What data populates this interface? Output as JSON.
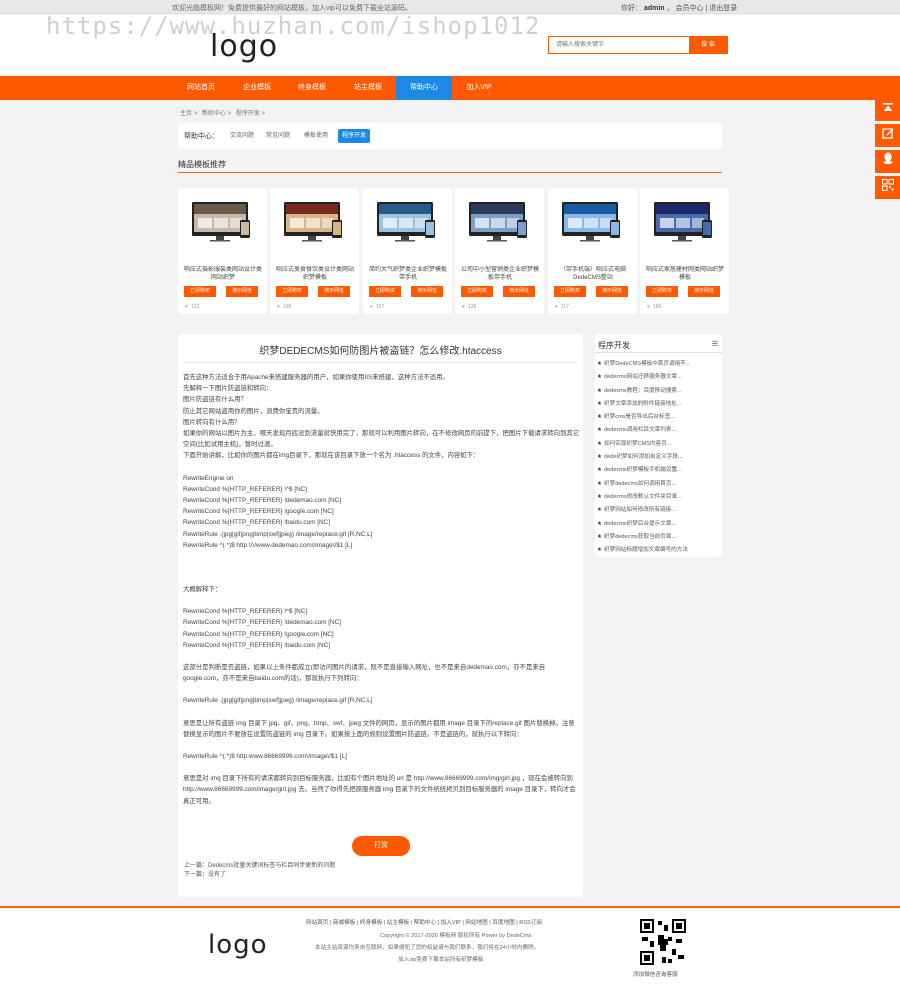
{
  "topbar": {
    "notice": "欢迎光临模板网！免费提供最好的网站模板，加入vip可以免费下载全站源码。",
    "welcome": "你好：",
    "user": "admin",
    "member": "会员中心",
    "logout": "退出登录"
  },
  "watermark": "https://www.huzhan.com/ishop1012",
  "header": {
    "logo": "logo",
    "search_placeholder": "请输入搜索关键字",
    "search_button": "搜 索"
  },
  "nav": {
    "items": [
      "网站首页",
      "企业模板",
      "终身模板",
      "站主模板",
      "帮助中心",
      "加入VIP"
    ]
  },
  "breadcrumb": [
    "主页",
    ">",
    "帮助中心",
    ">",
    "程序开发",
    ">"
  ],
  "help": {
    "label": "帮助中心：",
    "tabs": [
      "交流问题",
      "常见问题",
      "模板使用",
      "程序开发"
    ]
  },
  "section_title": "精品模板推荐",
  "cards": [
    {
      "title": "响应式摄影服装类网站设计类网站织梦",
      "buy": "立即购买",
      "demo": "演示网址",
      "views": "123"
    },
    {
      "title": "响应式美食餐饮类设计类网站织梦模板",
      "buy": "立即购买",
      "demo": "演示网址",
      "views": "198"
    },
    {
      "title": "简约大气织梦类企业织梦模板带手机",
      "buy": "立即购买",
      "demo": "演示网址",
      "views": "157"
    },
    {
      "title": "公司中小型营销类企业织梦模板带手机",
      "buy": "立即购买",
      "demo": "演示网址",
      "views": "138"
    },
    {
      "title": "（带手机端）响应式电脑DedeCMS整站",
      "buy": "立即购买",
      "demo": "演示网址",
      "views": "117"
    },
    {
      "title": "响应式家居建材网类网站织梦模板",
      "buy": "立即购买",
      "demo": "演示网址",
      "views": "189"
    }
  ],
  "article": {
    "title": "织梦DEDECMS如何防图片被盗链？怎么修改.htaccess",
    "lines": [
      "首先这种方法适合于用Apache来搭建服务器的用户，如果你使用IIS来搭建，这种方法不适用。",
      "先解释一下图片防盗链和转向：",
      "图片防盗链有什么用？",
      "防止其它网站盗用你的图片，浪费你宝贵的流量。",
      "图片转向有什么用？",
      "如果你的网站以图片为主，哪天发现月底没到流量就快用完了，那就可以利用图片转向，在不修改网页的前提下，把图片下载请求转向到其它空间(比如试用主机)，暂时过渡。",
      "下面开始讲解，比如你的图片都在img目录下，那就在该目录下放一个名为 .htaccess 的文件，内容如下：",
      "",
      "RewriteEngine on",
      "RewriteCond %{HTTP_REFERER} !^$ [NC]",
      "RewriteCond %{HTTP_REFERER} !dedemao.com [NC]",
      "RewriteCond %{HTTP_REFERER} !google.com [NC]",
      "RewriteCond %{HTTP_REFERER} !baidu.com [NC]",
      "RewriteRule .(jpg|gif|png|bmp|swf|jpeg) /image/replace.gif [R,NC,L]",
      "RewriteRule ^(.*)$ http:\\/\\/www.dedemao.com\\/image\\/$1 [L]",
      "",
      "",
      "",
      "大概解释下：",
      "",
      "RewriteCond %{HTTP_REFERER} !^$ [NC]",
      "RewriteCond %{HTTP_REFERER} !dedemao.com [NC]",
      "RewriteCond %{HTTP_REFERER} !google.com [NC]",
      "RewriteCond %{HTTP_REFERER} !baidu.com [NC]",
      "",
      "这部分是判断是否盗链，如果以上条件都成立(即访问图片的请求，既不是直接输入网址，也不是来自dedemao.com，亦不是来自google.com，亦不是来自baidu.com的话)，那就执行下列转向：",
      "",
      "RewriteRule .(jpg|gif|png|bmp|swf|jpeg) /image/replace.gif [R,NC,L]",
      "",
      "意思是让所有盗链 img 目录下 jpg、gif、png、bmp、swf、jpeg 文件的网页，显示的图片都用 image 目录下的replace.gif 图片替换掉。注意替换显示的图片不要放在设置防盗链的 img 目录下。如果按上面的规则设置图片防盗链，不是盗链的，就执行以下转向：",
      "",
      "RewriteRule ^(.*)$ http:www.86669999.com\\/image\\/$1 [L]",
      "",
      "意思是对 img 目录下所有的请求都转向到目标服务器，比如有个图片地址的 url 是 http://www.86669999.com/img/girl.jpg ，现在会被转向到 http://www.86669999.com/image/girl.jpg 去。当然了你得先把原服务器 img 目录下的文件统统拷贝到目标服务器的 image 目录下，转向才会真正可用。"
    ],
    "reward": "打赏",
    "prev": "上一篇：Dedecms批量关键词标签与栏目同步更新的问题",
    "next": "下一篇：没有了"
  },
  "sidebar": {
    "title": "程序开发",
    "items": [
      "织梦DedeCMS模板中首页调用不...",
      "dedecms网站迁移服务器文章...",
      "dedecms教程：百度移动搜索...",
      "织梦文章添加的附件链接地址...",
      "织梦cms是否导出后台标签...",
      "dedecms调用栏目文章列表...",
      "如何实现织梦CMS内容页...",
      "dede织梦如何添加自定义字段...",
      "dedecms织梦模板手机端设置...",
      "织梦dedecms如何调用首页...",
      "dedecms修改默认文件夹目录...",
      "织梦网站如何修改所有链接...",
      "dedecms织梦后台提示文章...",
      "织梦dedecms获取当前页面...",
      "织梦网站标题增加文章编号的方法"
    ]
  },
  "float_icons": [
    "up-arrow-icon",
    "edit-icon",
    "qq-icon",
    "qrcode-icon"
  ],
  "footer": {
    "logo": "logo",
    "links": "网站首页 | 商城模板 | 终身模板 | 站主模板 | 帮助中心 | 加入VIP | 网站地图 | 百度地图 | RSS订阅",
    "copyright": "Copyright © 2017-2020 模板网 版权所有 Power by DedeCms",
    "disclaimer": "本站主站资源均来自互联网，如果侵犯了您的权益请与我们联系，我们将在24小时内删除。",
    "vip": "加入vip免费下载本站所有织梦模板",
    "qr_label": "添加微信咨询客服"
  },
  "colors": {
    "accent": "#ff5a00",
    "active_nav": "#1e88e5"
  }
}
